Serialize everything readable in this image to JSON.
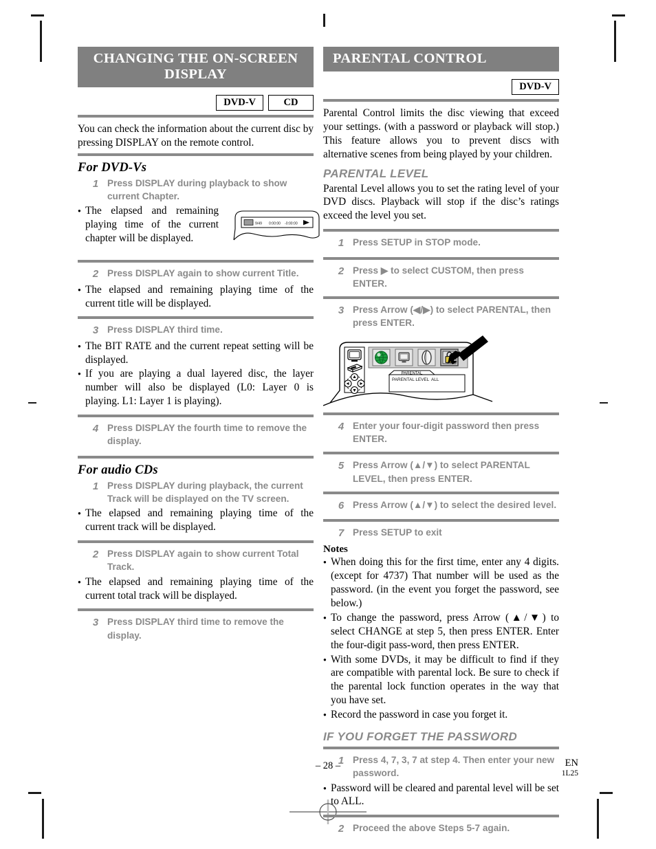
{
  "page": {
    "number": "– 28 –",
    "lang_code": "EN",
    "doc_code": "1L25"
  },
  "left_column": {
    "banner_title": "CHANGING THE ON-SCREEN DISPLAY",
    "badges": [
      "DVD-V",
      "CD"
    ],
    "intro": "You can check the information about the current disc by pressing DISPLAY on the remote control.",
    "section_dvd": {
      "heading": "For DVD-Vs",
      "steps": [
        {
          "num": "1",
          "text": "Press DISPLAY during playback to show current Chapter."
        },
        {
          "num": "2",
          "text": "Press DISPLAY again to show current Title."
        },
        {
          "num": "3",
          "text": "Press DISPLAY third time."
        },
        {
          "num": "4",
          "text": "Press DISPLAY the fourth time to remove the display."
        }
      ],
      "bullets_1": [
        "The elapsed and remaining playing time of the current chapter will be displayed."
      ],
      "bullets_2": [
        "The elapsed and remaining playing time of the current title will be displayed."
      ],
      "bullets_3": [
        "The BIT RATE and the current repeat setting will be displayed.",
        "If you are playing a dual layered disc, the layer number will also be displayed (L0: Layer 0 is playing. L1: Layer 1 is playing)."
      ],
      "osd": {
        "chapter": "9/49",
        "elapsed": "0:00:00",
        "remaining": "-0:00:00",
        "play_icon": "play-triangle-icon"
      }
    },
    "section_cd": {
      "heading": "For audio CDs",
      "steps": [
        {
          "num": "1",
          "text": "Press DISPLAY during playback, the current Track will be displayed on the TV screen."
        },
        {
          "num": "2",
          "text": "Press DISPLAY again to show current Total Track."
        },
        {
          "num": "3",
          "text": "Press DISPLAY third time to remove the display."
        }
      ],
      "bullets_1": [
        "The elapsed and remaining playing time of the current track will be displayed."
      ],
      "bullets_2": [
        "The elapsed and remaining playing time of the current total track will be displayed."
      ]
    }
  },
  "right_column": {
    "banner_title": "PARENTAL CONTROL",
    "badges": [
      "DVD-V"
    ],
    "intro": "Parental Control limits the disc viewing that exceed your settings. (with a password or playback will stop.) This feature allows you to prevent discs with alternative scenes from being played by your children.",
    "parental_level": {
      "heading": "PARENTAL LEVEL",
      "intro": "Parental Level allows you to set the rating level of your DVD discs. Playback will stop if the disc’s ratings exceed the level you set.",
      "steps": [
        {
          "num": "1",
          "text": "Press SETUP in STOP mode."
        },
        {
          "num": "2",
          "text": "Press ▶ to select CUSTOM, then press ENTER."
        },
        {
          "num": "3",
          "text": "Press Arrow (◀/▶) to select PARENTAL, then press ENTER."
        },
        {
          "num": "4",
          "text": "Enter your four-digit password then press ENTER."
        },
        {
          "num": "5",
          "text": "Press Arrow (▲/▼) to select PARENTAL LEVEL, then press ENTER."
        },
        {
          "num": "6",
          "text": "Press Arrow (▲/▼) to select the desired level."
        },
        {
          "num": "7",
          "text": "Press SETUP to exit"
        }
      ],
      "setup_menu": {
        "icons": [
          "globe-language-icon",
          "monitor-display-icon",
          "audio-icon",
          "lock-parental-icon"
        ],
        "selected_icon": "lock-parental-icon",
        "tab_label": "PARENTAL",
        "row_label": "PARENTAL LEVEL",
        "row_value": "ALL",
        "pointer": "arrow-pointer-icon",
        "device_icons": [
          "tv-icon",
          "remote-control-icon",
          "dpad-icon"
        ],
        "dpad_arrows": [
          "▲",
          "◀",
          "▶",
          "▼"
        ],
        "colors": {
          "globe": "#19a03c",
          "lock": "#e0c83a",
          "panel": "#d4d4d4",
          "selected_border": "#4a4a4a"
        }
      }
    },
    "notes": {
      "heading": "Notes",
      "items": [
        "When doing this for the first time, enter any 4 digits. (except for 4737) That number will be used as the password. (in the event you forget the password, see below.)",
        "To change the password, press Arrow (▲/▼) to select CHANGE at step 5, then press ENTER. Enter the four-digit pass-word, then press ENTER.",
        "With some DVDs, it may be difficult to find if they are compatible with parental lock. Be sure to check if the parental lock function operates in the way that you have set.",
        "Record the password in case you forget it."
      ]
    },
    "forget_password": {
      "heading": "IF YOU FORGET THE PASSWORD",
      "steps": [
        {
          "num": "1",
          "text": "Press 4, 7, 3, 7 at step 4. Then enter your new password."
        },
        {
          "num": "2",
          "text": "Proceed the above Steps 5-7 again."
        }
      ],
      "bullets_1": [
        "Password will be cleared and parental level will be set to ALL."
      ]
    }
  }
}
